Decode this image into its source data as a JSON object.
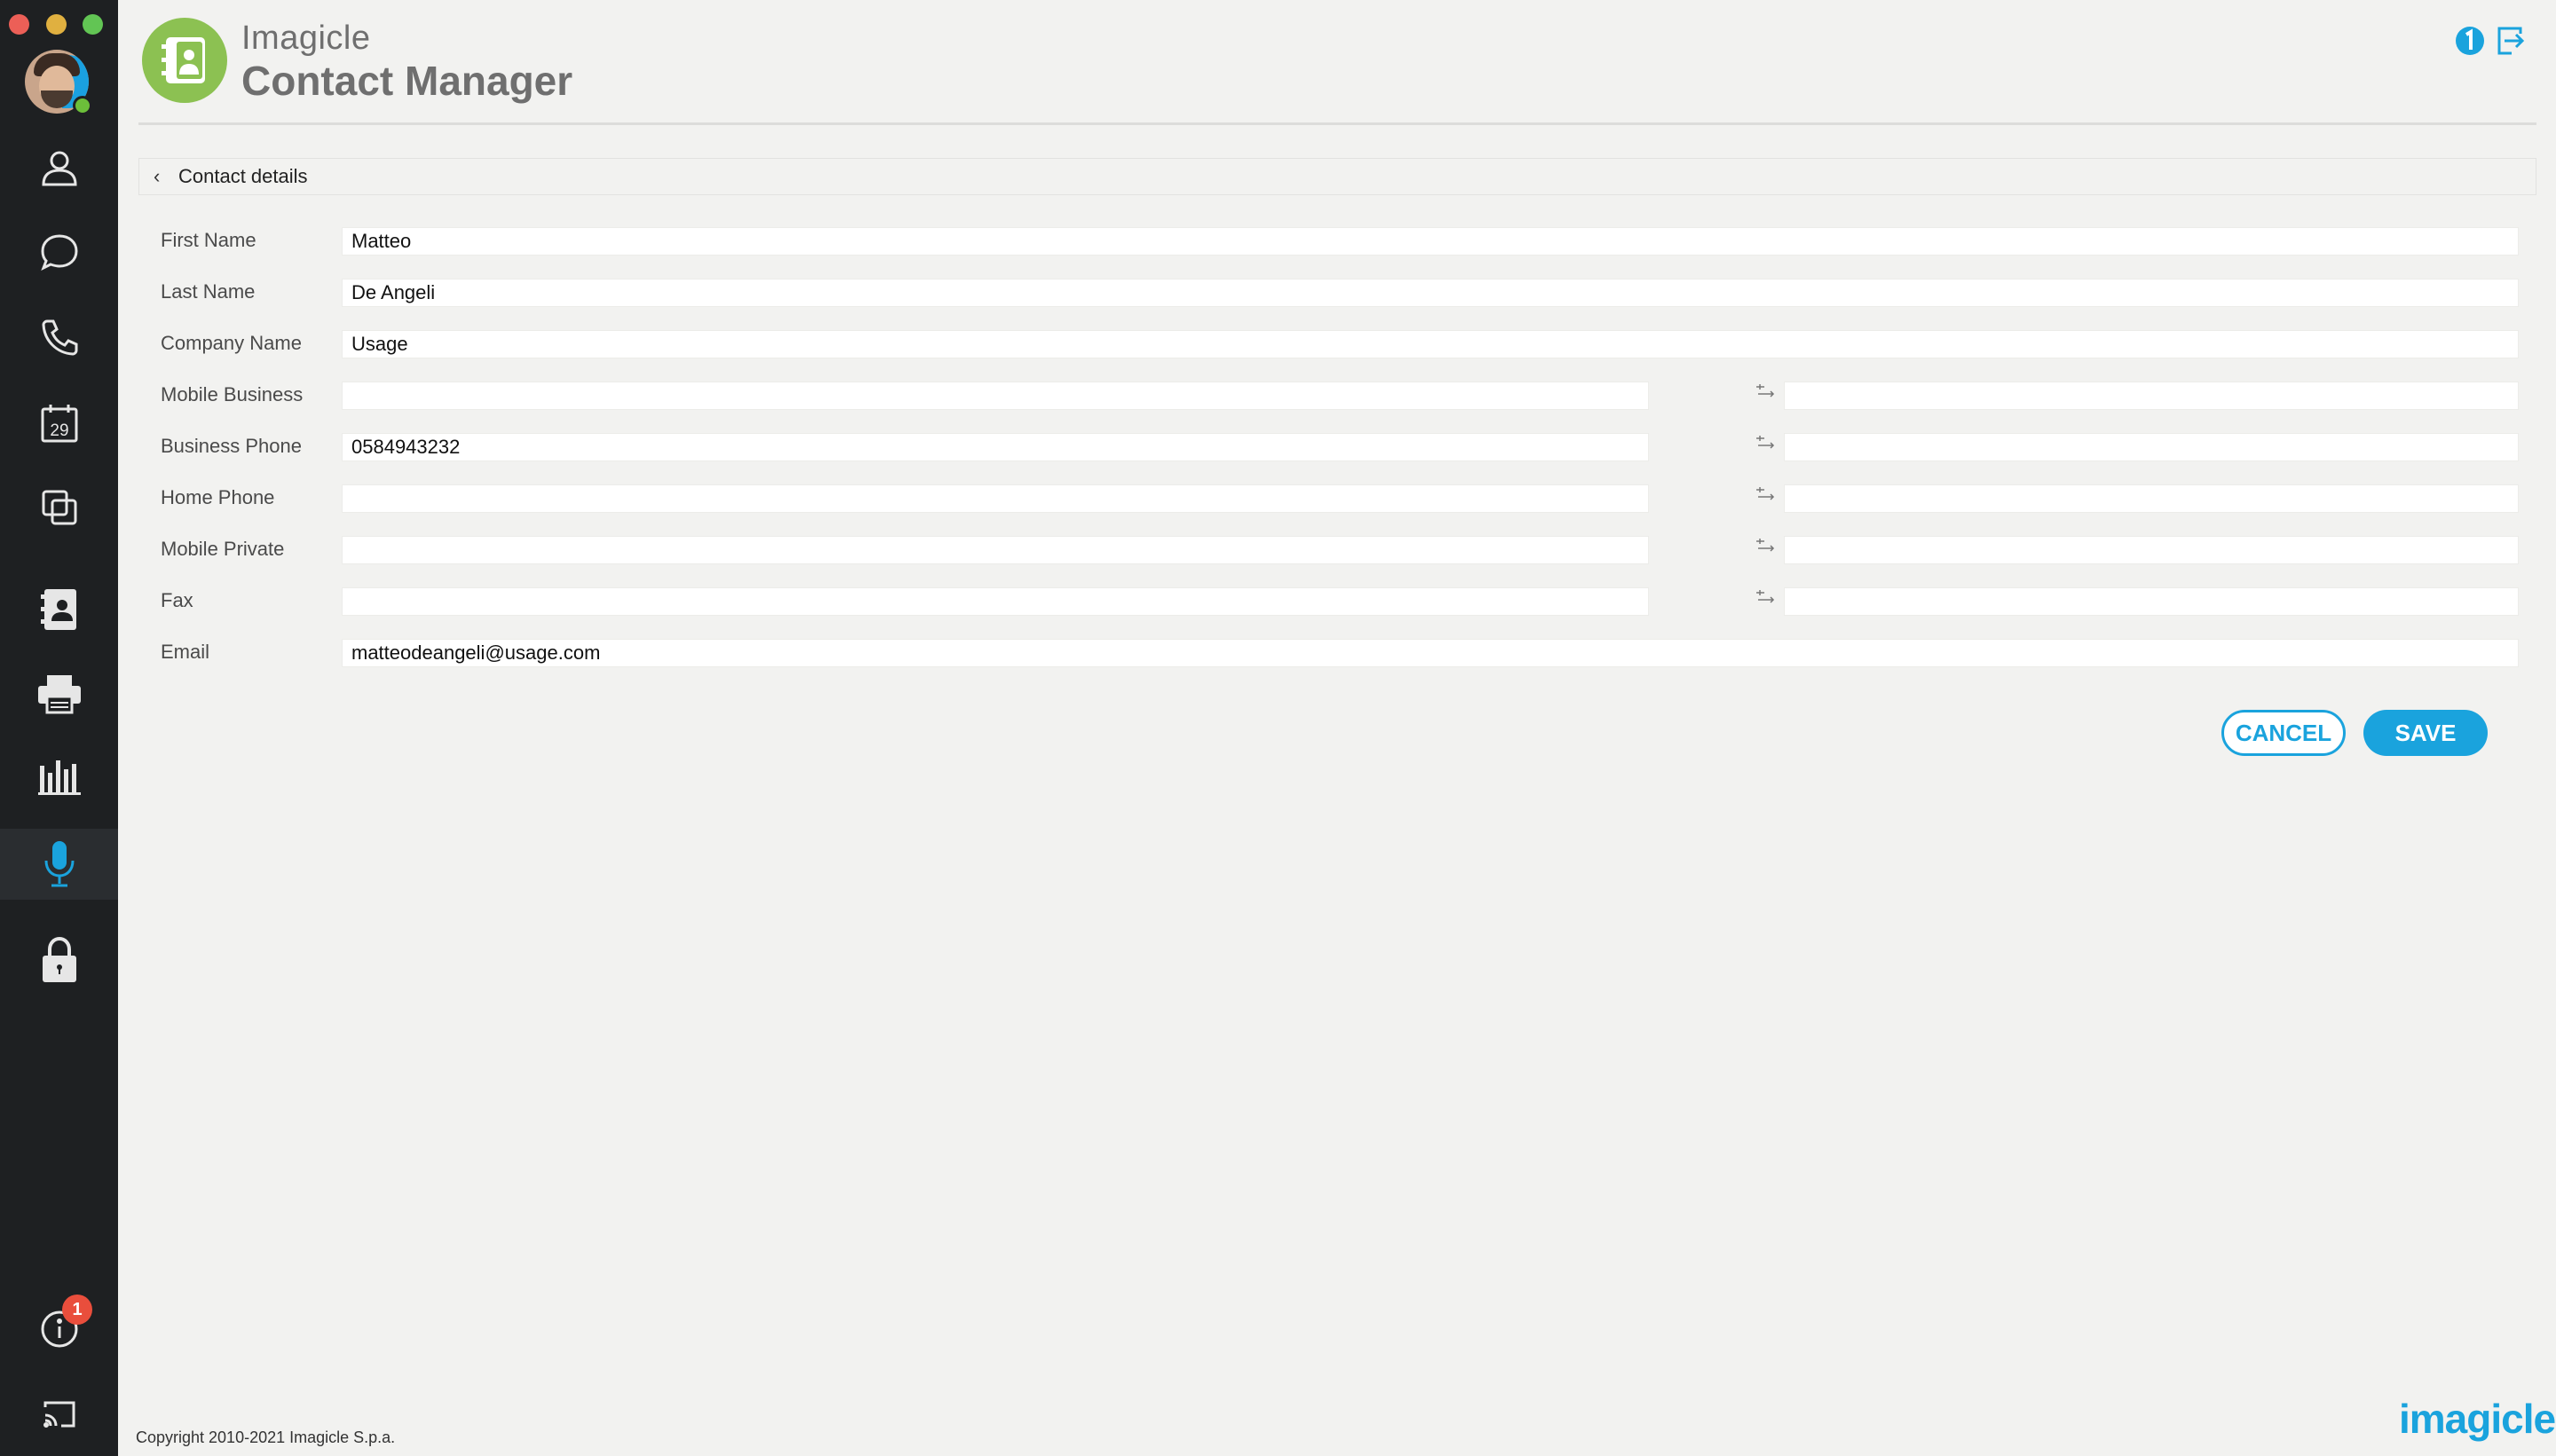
{
  "window": {
    "controls": [
      {
        "name": "close",
        "color": "#ec5f57"
      },
      {
        "name": "minimize",
        "color": "#e0b040"
      },
      {
        "name": "maximize",
        "color": "#62c554"
      }
    ]
  },
  "sidebar": {
    "presence_color": "#6cbf3a",
    "items": [
      {
        "icon": "contacts-person-icon"
      },
      {
        "icon": "chat-bubble-icon"
      },
      {
        "icon": "phone-icon"
      },
      {
        "icon": "calendar-icon",
        "label": "29"
      },
      {
        "icon": "copy-windows-icon"
      },
      {
        "icon": "contact-manager-book-icon"
      },
      {
        "icon": "fax-printer-icon"
      },
      {
        "icon": "bar-chart-icon"
      },
      {
        "icon": "microphone-icon",
        "active": true
      },
      {
        "icon": "lock-icon"
      }
    ],
    "info_badge": "1"
  },
  "header": {
    "brand_top": "Imagicle",
    "brand_main": "Contact Manager"
  },
  "detail": {
    "title": "Contact details"
  },
  "form": {
    "fields": [
      {
        "label": "First Name",
        "value": "Matteo"
      },
      {
        "label": "Last Name",
        "value": "De Angeli"
      },
      {
        "label": "Company Name",
        "value": "Usage"
      },
      {
        "label": "Mobile Business",
        "value": "",
        "extra": ""
      },
      {
        "label": "Business Phone",
        "value": "0584943232",
        "extra": ""
      },
      {
        "label": "Home Phone",
        "value": "",
        "extra": ""
      },
      {
        "label": "Mobile Private",
        "value": "",
        "extra": ""
      },
      {
        "label": "Fax",
        "value": "",
        "extra": ""
      },
      {
        "label": "Email",
        "value": "matteodeangeli@usage.com"
      }
    ]
  },
  "actions": {
    "cancel": "CANCEL",
    "save": "SAVE"
  },
  "footer": {
    "copyright": "Copyright 2010-2021 Imagicle S.p.a.",
    "brand": "imagicle"
  },
  "colors": {
    "accent": "#1aa3dd",
    "logo_green": "#8cc152",
    "sidebar_bg": "#1e2022",
    "notification_red": "#e94e3c"
  }
}
